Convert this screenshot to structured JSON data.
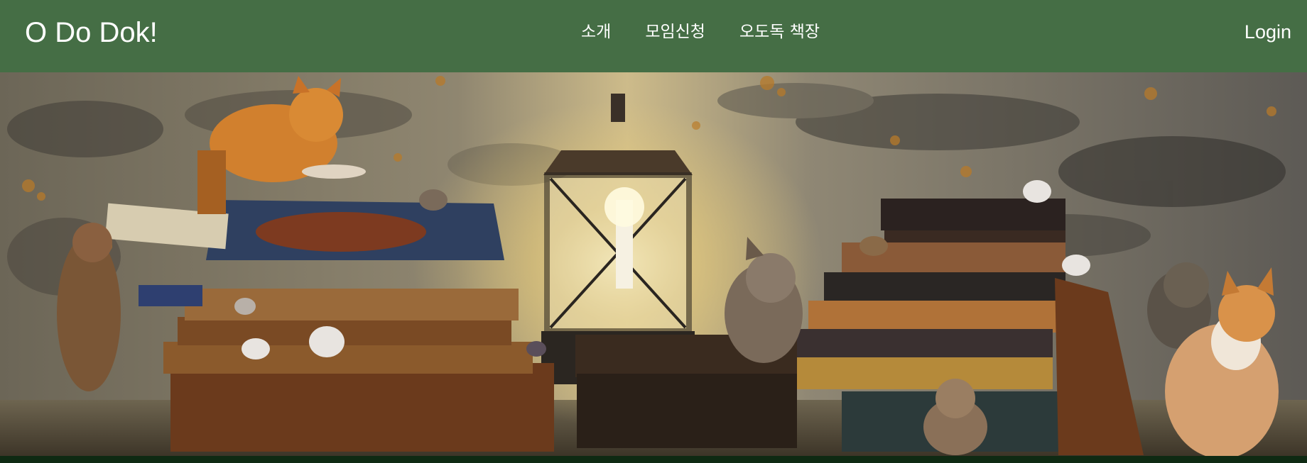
{
  "navbar": {
    "brand": "O Do Dok!",
    "links": [
      "소개",
      "모임신청",
      "오도독 책장"
    ],
    "login": "Login",
    "background_color": "#456e45",
    "text_color": "#ffffff"
  },
  "hero": {
    "image_description_icon": "hero-illustration"
  },
  "footer": {
    "background_color": "#0f2a13"
  }
}
